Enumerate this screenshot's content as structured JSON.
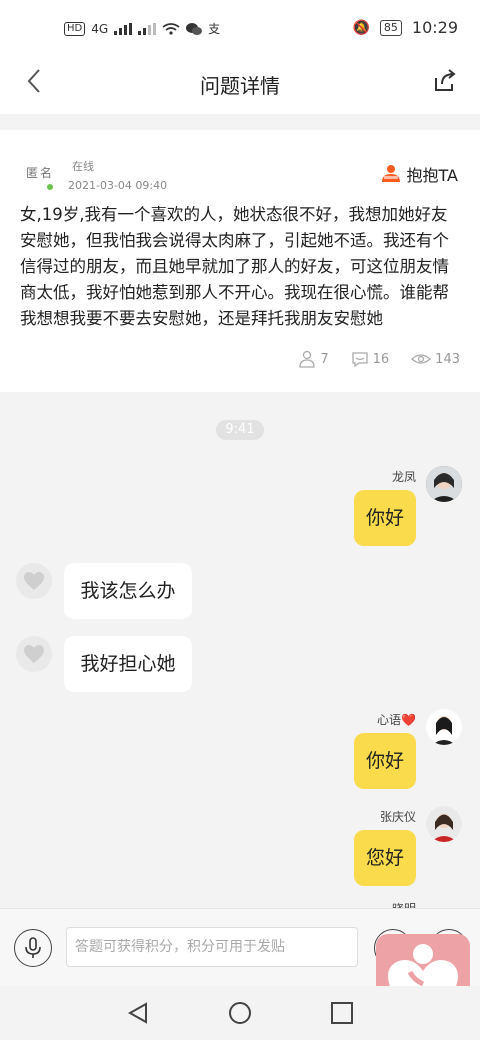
{
  "status_bar": {
    "left_indicators": [
      "HD",
      "4G",
      "Wi‑Fi",
      "WeChat",
      "Alipay"
    ],
    "battery": "85",
    "time": "10:29"
  },
  "nav": {
    "title": "问题详情",
    "back_icon": "chevron-left-icon",
    "share_icon": "share-icon"
  },
  "post": {
    "author_label": "匿名",
    "online_status": "在线",
    "date": "2021-03-04 09:40",
    "hug_label": "抱抱TA",
    "content": "女,19岁,我有一个喜欢的人，她状态很不好，我想加她好友安慰她，但我怕我会说得太肉麻了，引起她不适。我还有个信得过的朋友，而且她早就加了那人的好友，可这位朋友情商太低，我好怕她惹到那人不开心。我现在很心慌。谁能帮我想想我要不要去安慰她，还是拜托我朋友安慰她",
    "stats": {
      "hugs": "7",
      "comments": "16",
      "views": "143"
    }
  },
  "chat": {
    "time_divider": "9:41",
    "messages": [
      {
        "side": "right",
        "name": "龙凤",
        "text": "你好"
      },
      {
        "side": "left",
        "text": "我该怎么办"
      },
      {
        "side": "left",
        "text": "我好担心她"
      },
      {
        "side": "right",
        "name": "心语❤️",
        "text": "你好"
      },
      {
        "side": "right",
        "name": "张庆仪",
        "text": "您好"
      },
      {
        "side": "right",
        "name": "晓明",
        "text": ""
      }
    ]
  },
  "input_bar": {
    "placeholder": "答题可获得积分，积分可用于发贴"
  },
  "colors": {
    "accent_yellow": "#fadb4b",
    "hug_orange": "#ff5a1f",
    "online_green": "#6cc24a",
    "floating_pink": "#eda3a6"
  }
}
